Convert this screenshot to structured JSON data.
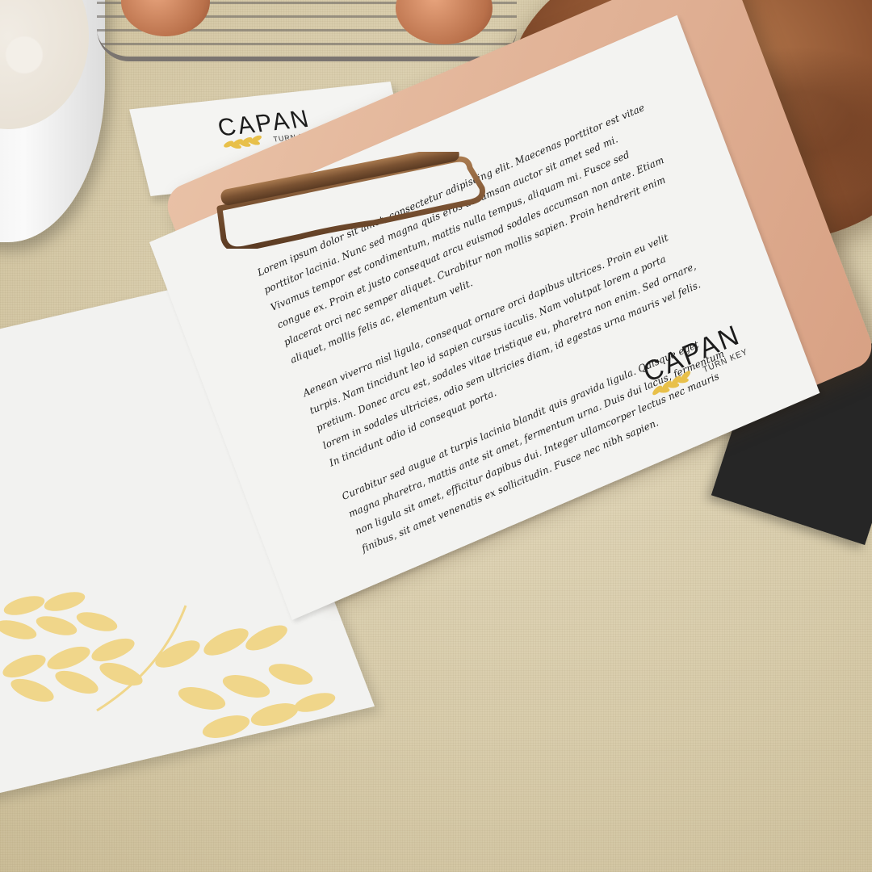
{
  "brand": {
    "name": "CAPAN",
    "tagline": "TURN KEY",
    "accent_color": "#e8c04a"
  },
  "letter": {
    "paragraphs": [
      "Lorem ipsum dolor sit amet, consectetur adipiscing elit. Maecenas porttitor est vitae porttitor lacinia. Nunc sed magna quis eros accumsan auctor sit amet sed mi. Vivamus tempor est condimentum, mattis nulla tempus, aliquam mi. Fusce sed congue ex. Proin et justo consequat arcu euismod sodales accumsan non ante. Etiam placerat orci nec semper aliquet. Curabitur non mollis sapien. Proin hendrerit enim aliquet, mollis felis ac, elementum velit.",
      "Aenean viverra nisl ligula, consequat ornare orci dapibus ultrices. Proin eu velit turpis. Nam tincidunt leo id sapien cursus iaculis. Nam volutpat lorem a porta pretium. Donec arcu est, sodales vitae tristique eu, pharetra non enim. Sed ornare, lorem in sodales ultricies, odio sem ultricies diam, id egestas urna mauris vel felis. In tincidunt odio id consequat porta.",
      "Curabitur sed augue at turpis lacinia blandit quis gravida ligula. Quisque eget magna pharetra, mattis ante sit amet, fermentum urna. Duis dui lacus, fermentum non ligula sit amet, efficitur dapibus dui. Integer ullamcorper lectus nec mauris finibus, sit amet venenatis ex sollicitudin. Fusce nec nibh sapien."
    ]
  }
}
